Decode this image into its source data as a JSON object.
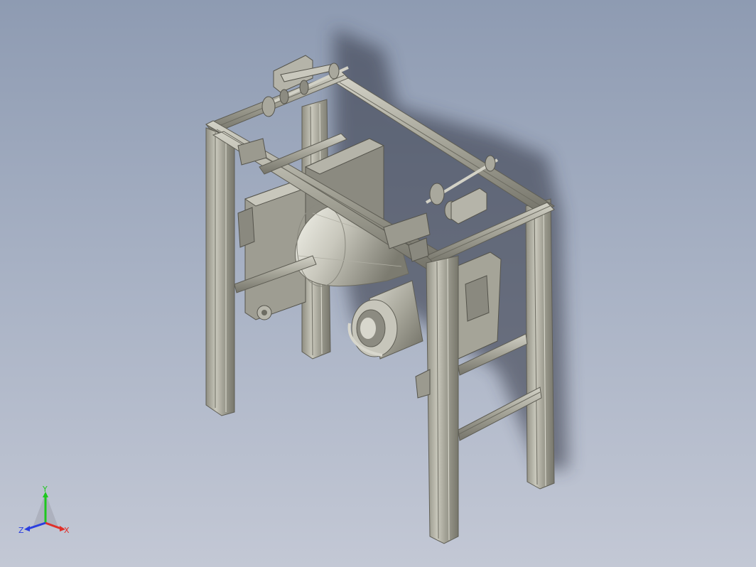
{
  "viewport": {
    "background_top": "#8e9bb2",
    "background_bottom": "#c3c8d5"
  },
  "model": {
    "frame_color": "#a7a699",
    "frame_dark": "#6f6e63",
    "metal_highlight": "#e3e3d8"
  },
  "triad": {
    "x_label": "X",
    "y_label": "Y",
    "z_label": "Z",
    "x_color": "#e0302a",
    "y_color": "#1ec81e",
    "z_color": "#2a3ee0"
  }
}
